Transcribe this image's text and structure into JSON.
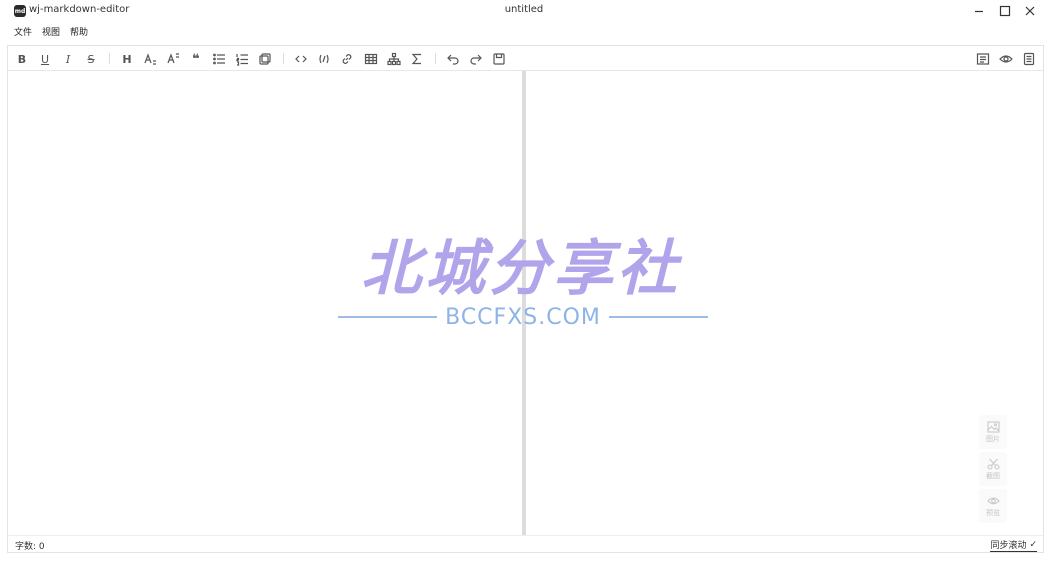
{
  "window": {
    "logo_text": "md",
    "app_name": "wj-markdown-editor",
    "doc_title": "untitled"
  },
  "menu": [
    "文件",
    "视图",
    "帮助"
  ],
  "toolbar": {
    "bold": "B",
    "underline": "U",
    "italic": "I",
    "strike": "S",
    "heading": "H",
    "subscript": "A",
    "superscript": "A",
    "quote": "❝"
  },
  "status": {
    "word_count": "字数: 0",
    "sync_scroll": "同步滚动",
    "sync_check": "✓"
  },
  "float_tools": {
    "image": "图片",
    "screenshot": "截图",
    "preview": "预览"
  },
  "watermark": {
    "main": "北城分享社",
    "sub": "BCCFXS.COM"
  },
  "colors": {
    "watermark_main": "#b2a4ea",
    "watermark_sub": "#8db4e6",
    "splitter": "#dcdcdc"
  }
}
